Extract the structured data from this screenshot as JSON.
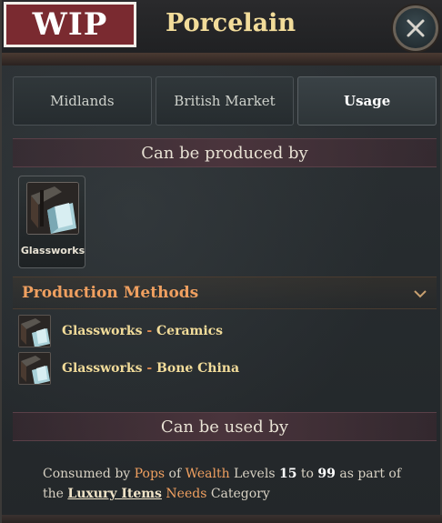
{
  "header": {
    "wip_badge": "WIP",
    "title": "Porcelain",
    "close_icon": "close-icon"
  },
  "tabs": [
    {
      "label": "Midlands",
      "active": false
    },
    {
      "label": "British Market",
      "active": false
    },
    {
      "label": "Usage",
      "active": true
    }
  ],
  "produced_by": {
    "heading": "Can be produced by",
    "buildings": [
      {
        "label": "Glassworks",
        "icon": "glassworks-icon"
      }
    ]
  },
  "production_methods": {
    "heading": "Production Methods",
    "items": [
      {
        "building": "Glassworks",
        "separator": "-",
        "method": "Ceramics",
        "icon": "glassworks-icon"
      },
      {
        "building": "Glassworks",
        "separator": "-",
        "method": "Bone China",
        "icon": "glassworks-icon"
      }
    ]
  },
  "used_by": {
    "heading": "Can be used by",
    "text": {
      "p1": "Consumed by ",
      "pops": "Pops",
      "p2": " of ",
      "wealth": "Wealth",
      "p3": " Levels ",
      "min_level": "15",
      "p4": " to ",
      "max_level": "99",
      "p5": " as part of the ",
      "category_link": "Luxury Items",
      "p6": " ",
      "needs": "Needs",
      "p7": " Category"
    }
  },
  "colors": {
    "title": "#f2dc9a",
    "accent_orange": "#f0a060",
    "wip_badge": "#7a2a30"
  }
}
